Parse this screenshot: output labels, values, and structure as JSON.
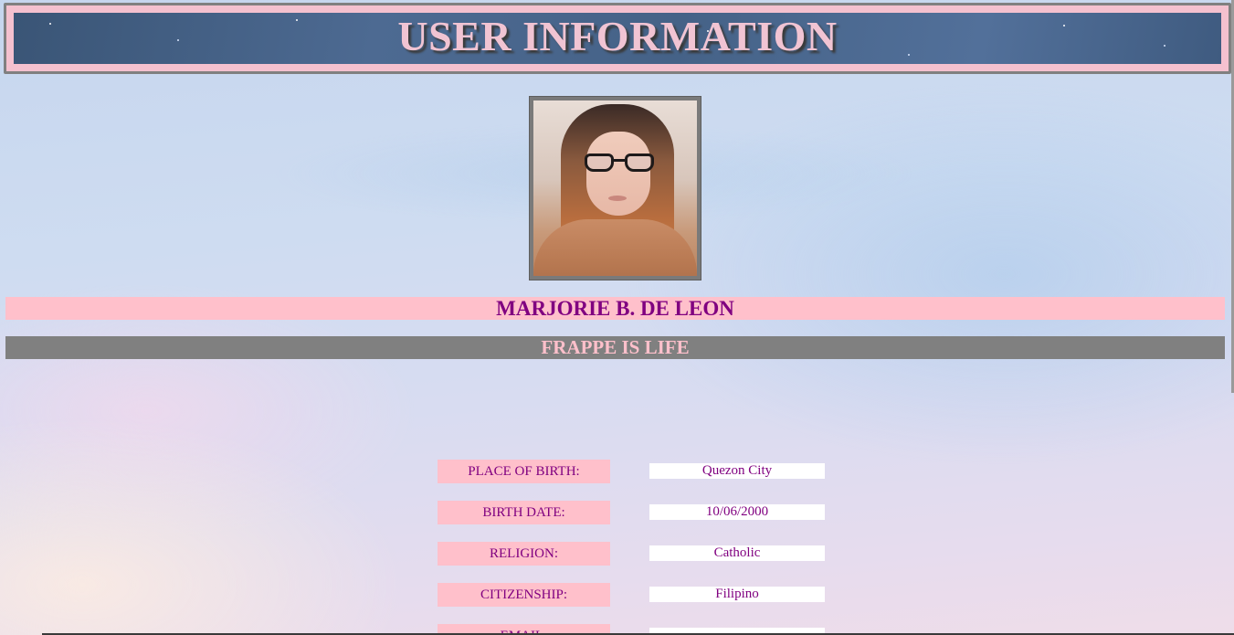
{
  "header": {
    "title": "USER INFORMATION"
  },
  "profile": {
    "photo_icon": "profile-photo",
    "name": "MARJORIE B. DE LEON",
    "motto": "FRAPPE IS LIFE"
  },
  "info": [
    {
      "label": "PLACE OF BIRTH:",
      "value": "Quezon City"
    },
    {
      "label": "BIRTH DATE:",
      "value": "10/06/2000"
    },
    {
      "label": "RELIGION:",
      "value": "Catholic"
    },
    {
      "label": "CITIZENSHIP:",
      "value": "Filipino"
    },
    {
      "label": "EMAIL:",
      "value": ""
    }
  ],
  "colors": {
    "pink": "#ffc0cb",
    "purple": "#800080",
    "gray": "#808080",
    "header_text": "#f1c4d3"
  }
}
